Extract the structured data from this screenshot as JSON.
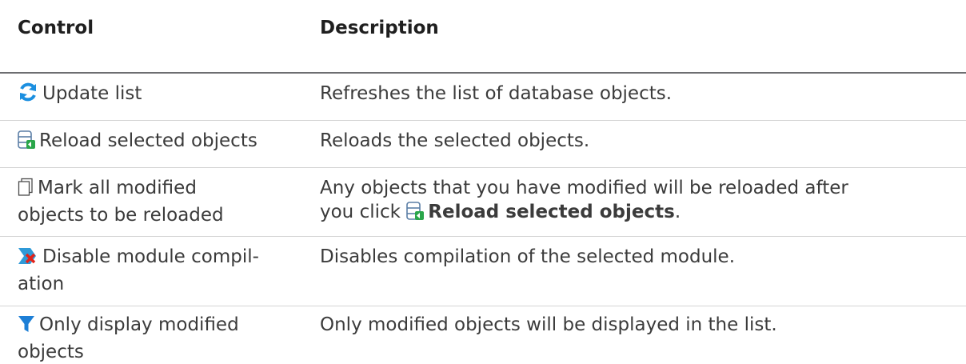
{
  "header": {
    "control": "Control",
    "description": "Description"
  },
  "rows": [
    {
      "icon": "refresh-icon",
      "control": "Update list",
      "description": "Refreshes the list of database objects."
    },
    {
      "icon": "database-reload-icon",
      "control": "Reload selected objects",
      "description": "Reloads the selected objects."
    },
    {
      "icon": "document-copy-icon",
      "control_line1": "Mark all modified",
      "control_line2": "objects to be reloaded",
      "description_line1": "Any objects that you have modified will be reloaded after",
      "description_line2_prefix": "you click",
      "description_line2_bold": "Reload selected objects",
      "description_line2_suffix": "."
    },
    {
      "icon": "disable-compile-icon",
      "control_line1": "Disable module compil-",
      "control_line2": "ation",
      "description": "Disables compilation of the selected module."
    },
    {
      "icon": "filter-icon",
      "control_line1": "Only display modified",
      "control_line2": "objects",
      "description": "Only modified objects will be displayed in the list."
    }
  ],
  "colors": {
    "refresh_blue": "#1b8fe0",
    "filter_blue": "#1d7fd6",
    "disable_red": "#e2231a"
  }
}
